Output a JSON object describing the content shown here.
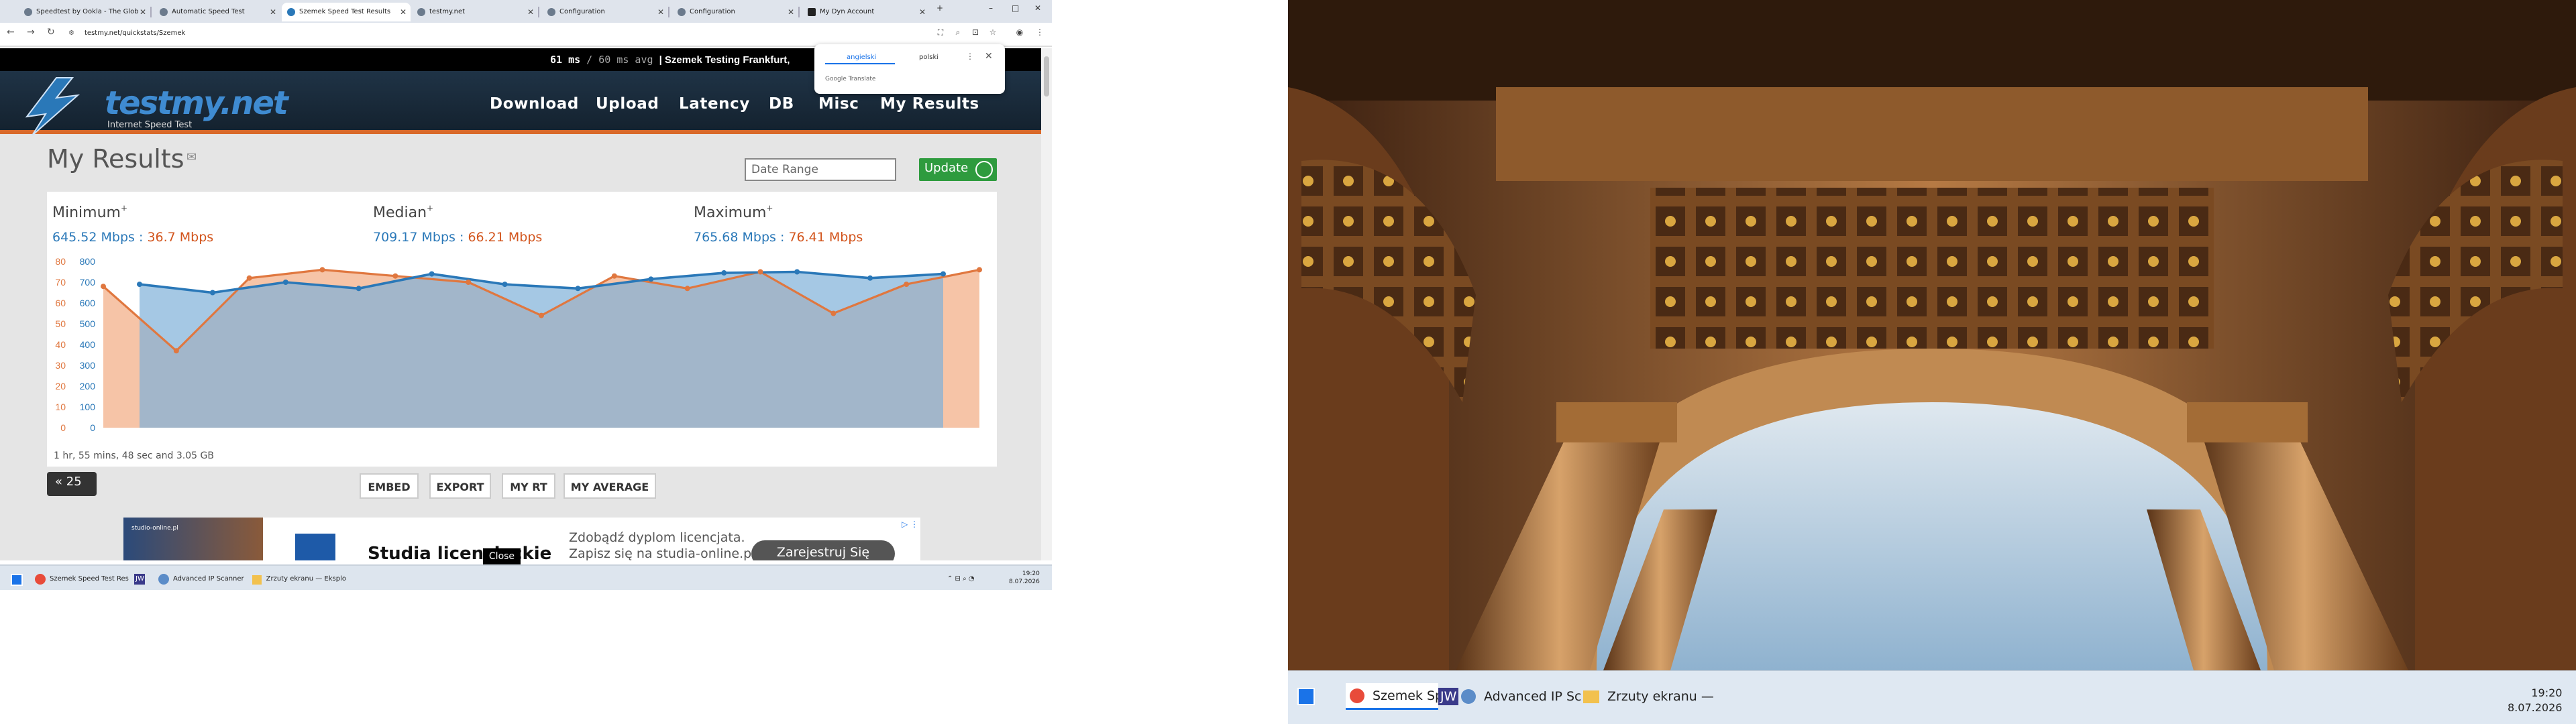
{
  "browser": {
    "tabs": [
      {
        "title": "Speedtest by Ookla - The Glob",
        "active": false
      },
      {
        "title": "Automatic Speed Test",
        "active": false
      },
      {
        "title": "Szemek Speed Test Results",
        "active": true
      },
      {
        "title": "testmy.net",
        "active": false
      },
      {
        "title": "Configuration",
        "active": false
      },
      {
        "title": "Configuration",
        "active": false
      },
      {
        "title": "My Dyn Account",
        "active": false
      }
    ],
    "url": "testmy.net/quickstats/Szemek"
  },
  "translate": {
    "lang1": "angielski",
    "lang2": "polski",
    "brand": "Google Translate"
  },
  "site": {
    "ping_ms": "61 ms",
    "ping_sep": " / ",
    "ping_avg": "60 ms avg",
    "testing": "| Szemek Testing Frankfurt,",
    "logo": "testmy.net",
    "logo_sub": "Internet Speed Test",
    "nav": [
      "Download",
      "Upload",
      "Latency",
      "DB",
      "Misc",
      "My Results"
    ]
  },
  "results": {
    "title": "My Results",
    "date_placeholder": "Date Range",
    "update_label": "Update",
    "stats": [
      {
        "label": "Minimum",
        "dl": "645.52 Mbps",
        "sep": " : ",
        "ul": "36.7 Mbps"
      },
      {
        "label": "Median",
        "dl": "709.17 Mbps",
        "sep": " : ",
        "ul": "66.21 Mbps"
      },
      {
        "label": "Maximum",
        "dl": "765.68 Mbps",
        "sep": " : ",
        "ul": "76.41 Mbps"
      }
    ],
    "duration": "1 hr, 55 mins, 48 sec and 3.05 GB",
    "page_label": "25",
    "buttons": [
      "EMBED",
      "EXPORT",
      "MY RT",
      "MY AVERAGE"
    ]
  },
  "chart_data": {
    "type": "area",
    "series": [
      {
        "name": "Download",
        "color": "#2a78b8",
        "axis_ticks": [
          "0",
          "100",
          "200",
          "300",
          "400",
          "500",
          "600",
          "700",
          "800"
        ],
        "values": [
          690,
          650,
          700,
          670,
          740,
          690,
          670,
          715,
          745,
          750,
          720,
          740
        ]
      },
      {
        "name": "Upload",
        "color": "#e0773f",
        "axis_ticks": [
          "0",
          "10",
          "20",
          "30",
          "40",
          "50",
          "60",
          "70",
          "80"
        ],
        "values": [
          68,
          37,
          72,
          76,
          73,
          70,
          54,
          73,
          67,
          75,
          55,
          69,
          76
        ]
      }
    ],
    "ylim_left": [
      0,
      80
    ],
    "ylim_right": [
      0,
      800
    ]
  },
  "ad": {
    "img_text": "studio-online.pl",
    "headline": "Studia licencjackie",
    "sub1": "Zdobądź dyplom licencjata.",
    "sub2": "Zapisz się na studia-online.pl",
    "cta": "Zarejestruj Się",
    "close": "Close"
  },
  "taskbar_left": {
    "items": [
      "Szemek Speed Test Res",
      "JW",
      "Advanced IP Scanner",
      "Zrzuty ekranu — Eksplo"
    ],
    "time": "19:20",
    "date": "8.07.2026"
  },
  "taskbar_right": {
    "items": [
      "Szemek Speed Test Res",
      "JW",
      "Advanced IP Scanner",
      "Zrzuty ekranu — Eksplo"
    ],
    "time": "19:20",
    "date": "8.07.2026"
  }
}
